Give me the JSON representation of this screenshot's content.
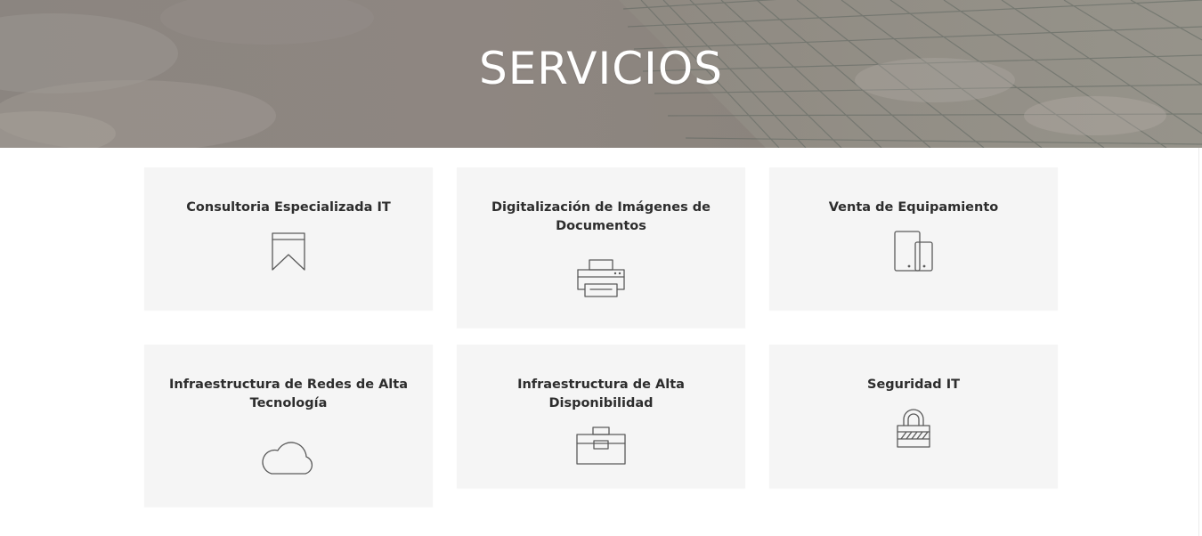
{
  "hero": {
    "title": "SERVICIOS"
  },
  "services": [
    {
      "title": "Consultoria Especializada IT",
      "icon": "bookmark-icon"
    },
    {
      "title": "Digitalización de Imágenes de Documentos",
      "icon": "printer-icon"
    },
    {
      "title": "Venta de Equipamiento",
      "icon": "devices-icon"
    },
    {
      "title": "Infraestructura de Redes de Alta Tecnología",
      "icon": "cloud-icon"
    },
    {
      "title": "Infraestructura de Alta Disponibilidad",
      "icon": "toolbox-icon"
    },
    {
      "title": "Seguridad IT",
      "icon": "padlock-icon"
    }
  ]
}
